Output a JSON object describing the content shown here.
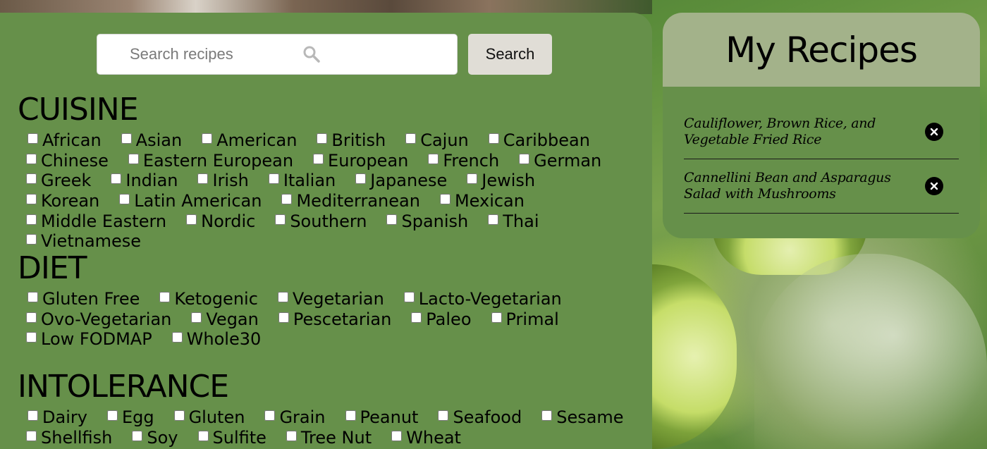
{
  "search": {
    "placeholder": "Search recipes",
    "button_label": "Search"
  },
  "cuisine": {
    "title": "CUISINE",
    "options": [
      "African",
      "Asian",
      "American",
      "British",
      "Cajun",
      "Caribbean",
      "Chinese",
      "Eastern European",
      "European",
      "French",
      "German",
      "Greek",
      "Indian",
      "Irish",
      "Italian",
      "Japanese",
      "Jewish",
      "Korean",
      "Latin American",
      "Mediterranean",
      "Mexican",
      "Middle Eastern",
      "Nordic",
      "Southern",
      "Spanish",
      "Thai",
      "Vietnamese"
    ]
  },
  "diet": {
    "title": "DIET",
    "options": [
      "Gluten Free",
      "Ketogenic",
      "Vegetarian",
      "Lacto-Vegetarian",
      "Ovo-Vegetarian",
      "Vegan",
      "Pescetarian",
      "Paleo",
      "Primal",
      "Low FODMAP",
      "Whole30"
    ]
  },
  "intolerance": {
    "title": "INTOLERANCE",
    "options": [
      "Dairy",
      "Egg",
      "Gluten",
      "Grain",
      "Peanut",
      "Seafood",
      "Sesame",
      "Shellfish",
      "Soy",
      "Sulfite",
      "Tree Nut",
      "Wheat"
    ]
  },
  "my_recipes": {
    "title": "My Recipes",
    "items": [
      {
        "name": "Cauliflower, Brown Rice, and Vegetable Fried Rice"
      },
      {
        "name": "Cannellini Bean and Asparagus Salad with Mushrooms"
      }
    ]
  },
  "colors": {
    "panel": "#66904a",
    "header": "#a3b28a",
    "search_button": "#e0ddd6"
  }
}
